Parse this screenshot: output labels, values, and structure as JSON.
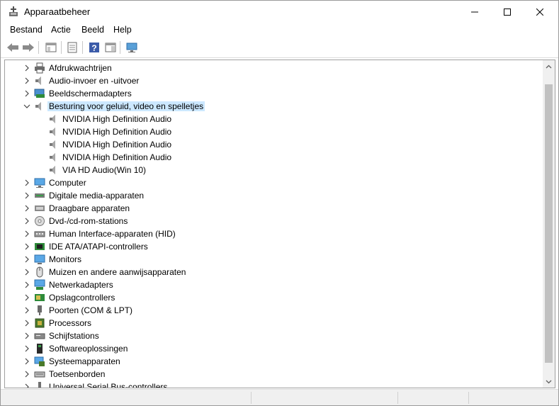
{
  "window": {
    "title": "Apparaatbeheer",
    "icon": "device-manager-icon",
    "controls": [
      "minimize-icon",
      "maximize-icon",
      "close-icon"
    ]
  },
  "menu": [
    "Bestand",
    "Actie",
    "Beeld",
    "Help"
  ],
  "toolbar": {
    "buttons": [
      "back-arrow-icon",
      "forward-arrow-icon",
      "show-hide-tree-icon",
      "properties-icon",
      "help-icon",
      "action-pane-icon",
      "scan-hardware-icon"
    ]
  },
  "tree": {
    "rows": [
      {
        "label": "Afdrukwachtrijen",
        "icon": "printer-icon",
        "level": 0,
        "expanded": false
      },
      {
        "label": "Audio-invoer en -uitvoer",
        "icon": "speaker-icon",
        "level": 0,
        "expanded": false
      },
      {
        "label": "Beeldschermadapters",
        "icon": "display-adapter-icon",
        "level": 0,
        "expanded": false
      },
      {
        "label": "Besturing voor geluid, video en spelletjes",
        "icon": "speaker-icon",
        "level": 0,
        "expanded": true,
        "selected": true
      },
      {
        "label": "NVIDIA High Definition Audio",
        "icon": "speaker-icon",
        "level": 1
      },
      {
        "label": "NVIDIA High Definition Audio",
        "icon": "speaker-icon",
        "level": 1
      },
      {
        "label": "NVIDIA High Definition Audio",
        "icon": "speaker-icon",
        "level": 1
      },
      {
        "label": "NVIDIA High Definition Audio",
        "icon": "speaker-icon",
        "level": 1
      },
      {
        "label": "VIA HD Audio(Win 10)",
        "icon": "speaker-icon",
        "level": 1
      },
      {
        "label": "Computer",
        "icon": "computer-icon",
        "level": 0,
        "expanded": false
      },
      {
        "label": "Digitale media-apparaten",
        "icon": "media-device-icon",
        "level": 0,
        "expanded": false
      },
      {
        "label": "Draagbare apparaten",
        "icon": "portable-device-icon",
        "level": 0,
        "expanded": false
      },
      {
        "label": "Dvd-/cd-rom-stations",
        "icon": "dvd-drive-icon",
        "level": 0,
        "expanded": false
      },
      {
        "label": "Human Interface-apparaten (HID)",
        "icon": "hid-icon",
        "level": 0,
        "expanded": false
      },
      {
        "label": "IDE ATA/ATAPI-controllers",
        "icon": "ide-controller-icon",
        "level": 0,
        "expanded": false
      },
      {
        "label": "Monitors",
        "icon": "monitor-icon",
        "level": 0,
        "expanded": false
      },
      {
        "label": "Muizen en andere aanwijsapparaten",
        "icon": "mouse-icon",
        "level": 0,
        "expanded": false
      },
      {
        "label": "Netwerkadapters",
        "icon": "network-adapter-icon",
        "level": 0,
        "expanded": false
      },
      {
        "label": "Opslagcontrollers",
        "icon": "storage-controller-icon",
        "level": 0,
        "expanded": false
      },
      {
        "label": "Poorten (COM & LPT)",
        "icon": "port-icon",
        "level": 0,
        "expanded": false
      },
      {
        "label": "Processors",
        "icon": "processor-icon",
        "level": 0,
        "expanded": false
      },
      {
        "label": "Schijfstations",
        "icon": "disk-drive-icon",
        "level": 0,
        "expanded": false
      },
      {
        "label": "Softwareoplossingen",
        "icon": "software-component-icon",
        "level": 0,
        "expanded": false
      },
      {
        "label": "Systeemapparaten",
        "icon": "system-device-icon",
        "level": 0,
        "expanded": false
      },
      {
        "label": "Toetsenborden",
        "icon": "keyboard-icon",
        "level": 0,
        "expanded": false
      },
      {
        "label": "Universal Serial Bus-controllers",
        "icon": "usb-icon",
        "level": 0,
        "expanded": false
      }
    ]
  },
  "colors": {
    "selection": "#cce8ff",
    "scrollbar_thumb": "#c1c1c1",
    "chrome": "#f0f0f0"
  }
}
